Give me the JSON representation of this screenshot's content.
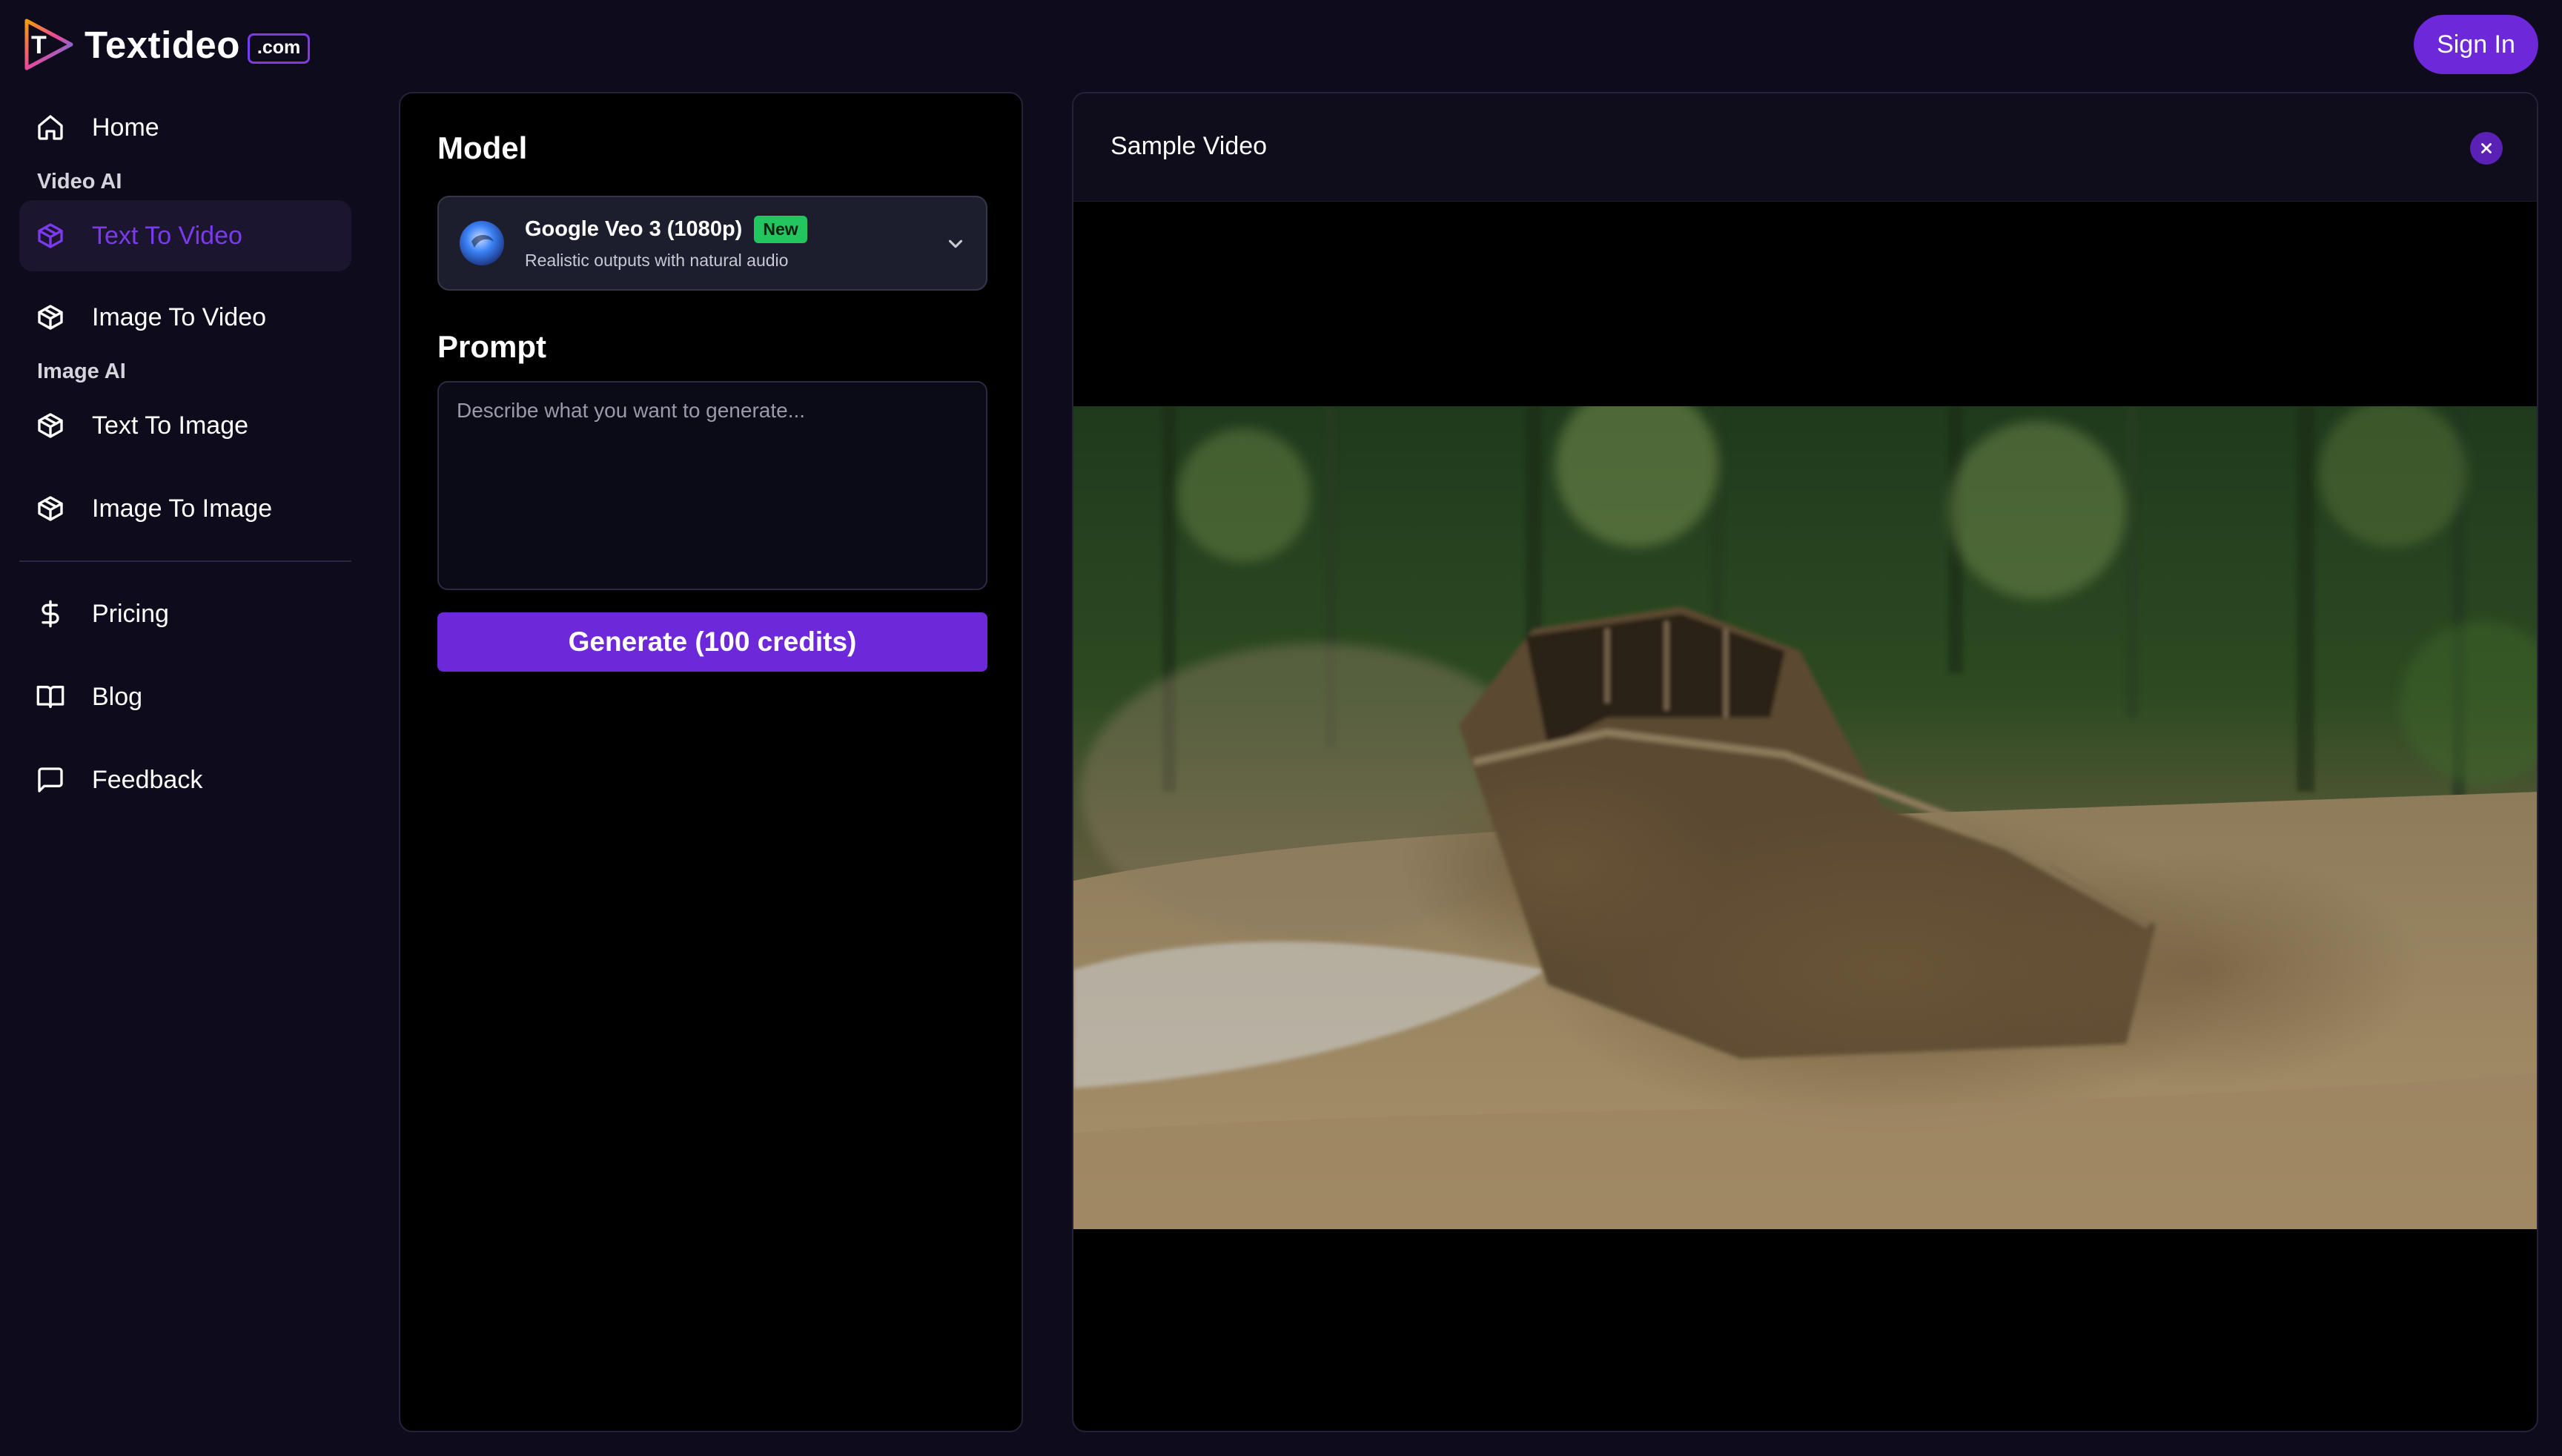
{
  "brand": {
    "name": "Textideo",
    "badge": ".com",
    "logo_letter": "T"
  },
  "header": {
    "signin_label": "Sign In"
  },
  "sidebar": {
    "home": "Home",
    "section_video": "Video AI",
    "text_to_video": "Text To Video",
    "image_to_video": "Image To Video",
    "section_image": "Image AI",
    "text_to_image": "Text To Image",
    "image_to_image": "Image To Image",
    "pricing": "Pricing",
    "blog": "Blog",
    "feedback": "Feedback",
    "active_item": "Text To Video"
  },
  "form": {
    "model_label": "Model",
    "model_name": "Google Veo 3 (1080p)",
    "model_badge": "New",
    "model_desc": "Realistic outputs with natural audio",
    "prompt_label": "Prompt",
    "prompt_value": "",
    "prompt_placeholder": "Describe what you want to generate...",
    "generate_label": "Generate (100 credits)"
  },
  "preview": {
    "title": "Sample Video"
  },
  "colors": {
    "background": "#0e0b1c",
    "accent": "#6d28d9",
    "accent_text": "#7c3aed",
    "badge_green": "#22c55e",
    "panel": "#000000"
  },
  "icons": {
    "home": "home-icon",
    "package": "package-icon",
    "dollar": "dollar-icon",
    "book": "book-icon",
    "message": "message-square-icon",
    "chevron": "chevron-down-icon",
    "close": "close-icon"
  }
}
